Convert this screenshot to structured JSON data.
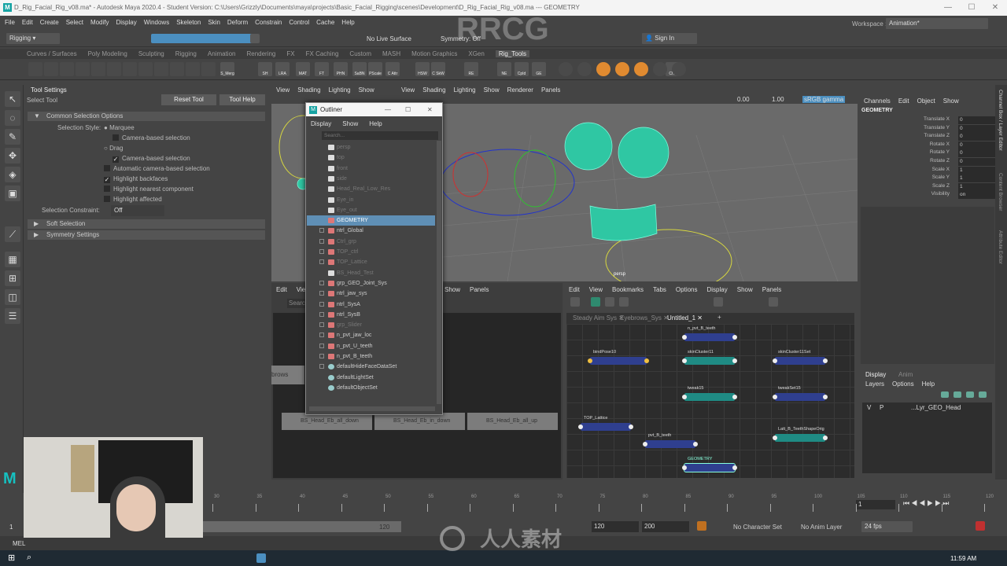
{
  "window": {
    "title": "D_Rig_Facial_Rig_v08.ma* - Autodesk Maya 2020.4 - Student Version: C:\\Users\\Grizzly\\Documents\\maya\\projects\\Basic_Facial_Rigging\\scenes\\Development\\D_Rig_Facial_Rig_v08.ma  ---  GEOMETRY",
    "logo": "M"
  },
  "menus": [
    "File",
    "Edit",
    "Create",
    "Select",
    "Modify",
    "Display",
    "Windows",
    "Skeleton",
    "Skin",
    "Deform",
    "Constrain",
    "Control",
    "Cache",
    "Help"
  ],
  "status": {
    "menuset": "Rigging",
    "live_surface": "No Live Surface",
    "symmetry": "Symmetry: Off",
    "sign_in": "Sign In",
    "workspace_label": "Workspace :",
    "workspace": "Animation*"
  },
  "shelf": {
    "tabs": [
      "Curves / Surfaces",
      "Poly Modeling",
      "Sculpting",
      "Rigging",
      "Animation",
      "Rendering",
      "FX",
      "FX Caching",
      "Custom",
      "MASH",
      "Motion Graphics",
      "XGen",
      "Rig_Tools"
    ],
    "active_tab": "Rig_Tools",
    "buttons": [
      "S_Merg",
      "SH",
      "LRA",
      "MAT",
      "FT",
      "PHN",
      "SaBN",
      "PScale",
      "C Attr",
      "HSW",
      "C SkW",
      "RE",
      "NE",
      "CpId",
      "GE",
      "Cho"
    ]
  },
  "tool_settings": {
    "tab": "Tool Settings",
    "tool": "Select Tool",
    "reset": "Reset Tool",
    "help": "Tool Help",
    "section": "Common Selection Options",
    "style_label": "Selection Style:",
    "marquee": "Marquee",
    "camera_based": "Camera-based selection",
    "drag": "Drag",
    "camera_based2": "Camera-based selection",
    "options": [
      {
        "label": "Automatic camera-based selection",
        "checked": false
      },
      {
        "label": "Highlight backfaces",
        "checked": true
      },
      {
        "label": "Highlight nearest component",
        "checked": false
      },
      {
        "label": "Highlight affected",
        "checked": false
      }
    ],
    "constraint_label": "Selection Constraint:",
    "constraint": "Off",
    "soft": "Soft Selection",
    "symmetry": "Symmetry Settings"
  },
  "viewport": {
    "menu_left": [
      "View",
      "Shading",
      "Lighting",
      "Show"
    ],
    "menu_right": [
      "View",
      "Shading",
      "Lighting",
      "Show",
      "Renderer",
      "Panels"
    ],
    "exposure": "0.00",
    "gamma": "1.00",
    "colorspace": "sRGB gamma",
    "camera": "persp"
  },
  "outliner": {
    "title": "Outliner",
    "menus": [
      "Display",
      "Show",
      "Help"
    ],
    "search": "Search...",
    "items": [
      {
        "label": "persp",
        "type": "camera",
        "dim": true
      },
      {
        "label": "top",
        "type": "camera",
        "dim": true
      },
      {
        "label": "front",
        "type": "camera",
        "dim": true
      },
      {
        "label": "side",
        "type": "camera",
        "dim": true
      },
      {
        "label": "Head_Real_Low_Res",
        "type": "mesh",
        "dim": true
      },
      {
        "label": "Eye_in",
        "type": "mesh",
        "dim": true
      },
      {
        "label": "Eye_out",
        "type": "mesh",
        "dim": true
      },
      {
        "label": "GEOMETRY",
        "type": "group",
        "selected": true
      },
      {
        "label": "ntrl_Global",
        "type": "group",
        "exp": true
      },
      {
        "label": "Ctrl_grp",
        "type": "group",
        "exp": true,
        "dim": true
      },
      {
        "label": "TOP_ctrl",
        "type": "group",
        "exp": true,
        "dim": true
      },
      {
        "label": "TOP_Lattice",
        "type": "group",
        "exp": true,
        "dim": true
      },
      {
        "label": "BS_Head_Test",
        "type": "mesh",
        "dim": true
      },
      {
        "label": "grp_GEO_Joint_Sys",
        "type": "group",
        "exp": true
      },
      {
        "label": "ntrl_jaw_sys",
        "type": "group",
        "exp": true
      },
      {
        "label": "ntrl_SysA",
        "type": "group",
        "exp": true
      },
      {
        "label": "ntrl_SysB",
        "type": "group",
        "exp": true
      },
      {
        "label": "grp_Slider",
        "type": "group",
        "exp": true,
        "dim": true
      },
      {
        "label": "n_pvt_jaw_loc",
        "type": "group",
        "exp": true
      },
      {
        "label": "n_pvt_U_teeth",
        "type": "group",
        "exp": true
      },
      {
        "label": "n_pvt_B_teeth",
        "type": "group",
        "exp": true
      },
      {
        "label": "defaultHideFaceDataSet",
        "type": "set",
        "exp": true
      },
      {
        "label": "defaultLightSet",
        "type": "set"
      },
      {
        "label": "defaultObjectSet",
        "type": "set"
      }
    ]
  },
  "graph": {
    "menus": [
      "Edit",
      "View"
    ],
    "menus_right": [
      "Show",
      "Panels"
    ],
    "search": "Search...",
    "clip": "brows",
    "blend_buttons": [
      "BS_Head_Eb_all_down",
      "BS_Head_Eb_in_down",
      "BS_Head_Eb_all_up"
    ]
  },
  "node_editor": {
    "menus": [
      "Edit",
      "View",
      "Bookmarks",
      "Tabs",
      "Options",
      "Display",
      "Show",
      "Panels"
    ],
    "tabs": [
      "Steady Aim Sys",
      "Eyebrows_Sys",
      "Untitled_1"
    ],
    "active_tab": "Untitled_1",
    "nodes": [
      {
        "name": "n_pvt_B_teeth",
        "kind": "transform"
      },
      {
        "name": "bindPose10",
        "kind": "bindpose"
      },
      {
        "name": "skinCluster11",
        "kind": "deformer"
      },
      {
        "name": "skinCluster11Set",
        "kind": "set"
      },
      {
        "name": "tweak15",
        "kind": "deformer"
      },
      {
        "name": "tweakSet15",
        "kind": "set"
      },
      {
        "name": "TOP_Lattice",
        "kind": "transform"
      },
      {
        "name": "Latt_B_TeethShapeOrig",
        "kind": "shape"
      },
      {
        "name": "pvt_B_teeth",
        "kind": "transform"
      },
      {
        "name": "GEOMETRY",
        "kind": "transform",
        "selected": true
      }
    ]
  },
  "channel_box": {
    "menus": [
      "Channels",
      "Edit",
      "Object",
      "Show"
    ],
    "object": "GEOMETRY",
    "attrs": [
      {
        "name": "Translate X",
        "value": "0"
      },
      {
        "name": "Translate Y",
        "value": "0"
      },
      {
        "name": "Translate Z",
        "value": "0"
      },
      {
        "name": "Rotate X",
        "value": "0"
      },
      {
        "name": "Rotate Y",
        "value": "0"
      },
      {
        "name": "Rotate Z",
        "value": "0"
      },
      {
        "name": "Scale X",
        "value": "1"
      },
      {
        "name": "Scale Y",
        "value": "1"
      },
      {
        "name": "Scale Z",
        "value": "1"
      },
      {
        "name": "Visibility",
        "value": "on"
      }
    ]
  },
  "side_tabs": [
    "Channel Box / Layer Editor",
    "Content Browser",
    "Attribute Editor"
  ],
  "layer_editor": {
    "tabs": [
      "Display",
      "Anim"
    ],
    "menus": [
      "Layers",
      "Options",
      "Help"
    ],
    "layer": {
      "v": "V",
      "p": "P",
      "name": "...Lyr_GEO_Head"
    }
  },
  "timeline": {
    "ticks": [
      "30",
      "35",
      "40",
      "45",
      "50",
      "55",
      "60",
      "65",
      "70",
      "75",
      "80",
      "85",
      "90",
      "95",
      "100",
      "105",
      "110",
      "115",
      "120"
    ],
    "current": "1"
  },
  "range": {
    "start": "1",
    "inner_end": "120",
    "end": "120",
    "max": "200",
    "character_set": "No Character Set",
    "anim_layer": "No Anim Layer",
    "fps": "24 fps"
  },
  "cmdline": {
    "label": "MEL"
  },
  "taskbar": {
    "time": "11:59 AM"
  },
  "watermarks": [
    "RRCG",
    "人人素材"
  ],
  "colors": {
    "accent": "#5f8fb5",
    "wire": "#3df0c0",
    "node_blue": "#2f3f8f",
    "node_teal": "#1f8b84"
  }
}
